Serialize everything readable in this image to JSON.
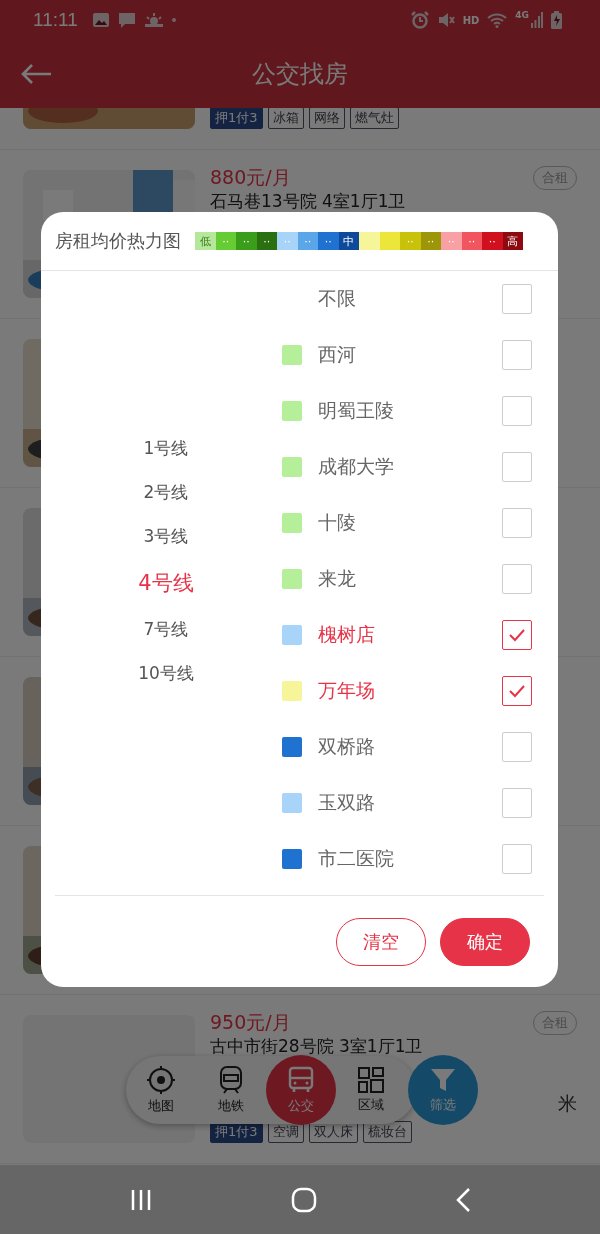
{
  "status_bar": {
    "time": "11:11",
    "network": "4G",
    "hd": "HD"
  },
  "header": {
    "title": "公交找房"
  },
  "listings": [
    {
      "image": {
        "kind": "picture"
      },
      "tags": [
        {
          "label": "押1付3",
          "kind": "deposit"
        },
        {
          "label": "冰箱",
          "kind": "amenity"
        },
        {
          "label": "网络",
          "kind": "amenity"
        },
        {
          "label": "燃气灶",
          "kind": "amenity"
        }
      ]
    },
    {
      "image": {
        "kind": "picture"
      },
      "price": "880元/月",
      "title": "石马巷13号院 4室1厅1卫",
      "badge": "合租"
    },
    {
      "image": {
        "kind": "picture"
      }
    },
    {
      "image": {
        "kind": "picture"
      }
    },
    {
      "image": {
        "kind": "picture"
      }
    },
    {
      "image": {
        "kind": "picture"
      }
    },
    {
      "image": {
        "kind": "blank"
      },
      "price": "950元/月",
      "title": "古中市街28号院 3室1厅1卫",
      "badge": "合租",
      "distance": "米",
      "tags": [
        {
          "label": "押1付3",
          "kind": "deposit"
        },
        {
          "label": "空调",
          "kind": "amenity"
        },
        {
          "label": "双人床",
          "kind": "amenity"
        },
        {
          "label": "梳妆台",
          "kind": "amenity"
        }
      ]
    }
  ],
  "bottom_tabs": [
    {
      "label": "地图",
      "kind": "map",
      "selected": false
    },
    {
      "label": "地铁",
      "kind": "metro",
      "selected": false
    },
    {
      "label": "公交",
      "kind": "bus",
      "selected": true
    },
    {
      "label": "区域",
      "kind": "area",
      "selected": false
    },
    {
      "label": "筛选",
      "kind": "filter",
      "selected": false
    }
  ],
  "dialog": {
    "title": "房租均价热力图",
    "legend": [
      {
        "label": "低",
        "color": "#b5e89a"
      },
      {
        "label": "··",
        "color": "#66cc33"
      },
      {
        "label": "··",
        "color": "#3a9e1a"
      },
      {
        "label": "··",
        "color": "#2a7010"
      },
      {
        "label": "··",
        "color": "#a8d4fa"
      },
      {
        "label": "··",
        "color": "#5aa6e8"
      },
      {
        "label": "··",
        "color": "#1f72d0"
      },
      {
        "label": "中",
        "color": "#0d4a9c"
      },
      {
        "color": "#f7f59a"
      },
      {
        "color": "#ece63a"
      },
      {
        "label": "··",
        "color": "#c8c20a"
      },
      {
        "label": "··",
        "color": "#9c9608"
      },
      {
        "label": "··",
        "color": "#f8a0a4"
      },
      {
        "label": "··",
        "color": "#f05560"
      },
      {
        "label": "··",
        "color": "#d0101e"
      },
      {
        "label": "高",
        "color": "#8c0a10"
      }
    ],
    "lines": [
      {
        "name": "1号线",
        "selected": false
      },
      {
        "name": "2号线",
        "selected": false
      },
      {
        "name": "3号线",
        "selected": false
      },
      {
        "name": "4号线",
        "selected": true
      },
      {
        "name": "7号线",
        "selected": false
      },
      {
        "name": "10号线",
        "selected": false
      }
    ],
    "stations": [
      {
        "name": "不限",
        "checked": false
      },
      {
        "name": "西河",
        "color": "#b5ef9a",
        "checked": false
      },
      {
        "name": "明蜀王陵",
        "color": "#b5ef9a",
        "checked": false
      },
      {
        "name": "成都大学",
        "color": "#b5ef9a",
        "checked": false
      },
      {
        "name": "十陵",
        "color": "#b5ef9a",
        "checked": false
      },
      {
        "name": "来龙",
        "color": "#b5ef9a",
        "checked": false
      },
      {
        "name": "槐树店",
        "color": "#a8d4fa",
        "checked": true
      },
      {
        "name": "万年场",
        "color": "#f7f59a",
        "checked": true
      },
      {
        "name": "双桥路",
        "color": "#1f72d0",
        "checked": false
      },
      {
        "name": "玉双路",
        "color": "#a8d4fa",
        "checked": false
      },
      {
        "name": "市二医院",
        "color": "#1f72d0",
        "checked": false
      }
    ],
    "buttons": [
      {
        "label": "清空",
        "kind": "secondary"
      },
      {
        "label": "确定",
        "kind": "primary"
      }
    ]
  }
}
